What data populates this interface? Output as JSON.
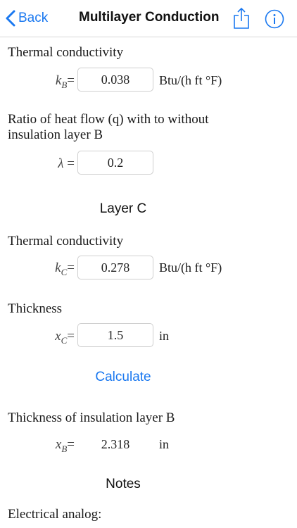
{
  "nav": {
    "back_label": "Back",
    "title": "Multilayer Conduction",
    "share_icon": "share-icon",
    "info_icon": "info-icon",
    "accent_color": "#1a78f0"
  },
  "kb": {
    "label": "Thermal conductivity",
    "var": "k",
    "sub": "B",
    "eq": "=",
    "value": "0.038",
    "unit": "Btu/(h ft °F)"
  },
  "ratio": {
    "label": "Ratio of heat flow (q) with to without insulation layer B",
    "var": "λ",
    "eq": " =",
    "value": "0.2"
  },
  "layer_c": {
    "title": "Layer C"
  },
  "kc": {
    "label": "Thermal conductivity",
    "var": "k",
    "sub": "C",
    "eq": "=",
    "value": "0.278",
    "unit": "Btu/(h ft °F)"
  },
  "xc": {
    "label": "Thickness",
    "var": "x",
    "sub": "C",
    "eq": "=",
    "value": "1.5",
    "unit": "in"
  },
  "calculate_label": "Calculate",
  "xb": {
    "label": "Thickness of insulation layer B",
    "var": "x",
    "sub": "B",
    "eq": "=",
    "value": "2.318",
    "unit": "in"
  },
  "notes": {
    "title": "Notes",
    "text": "Electrical analog:"
  }
}
